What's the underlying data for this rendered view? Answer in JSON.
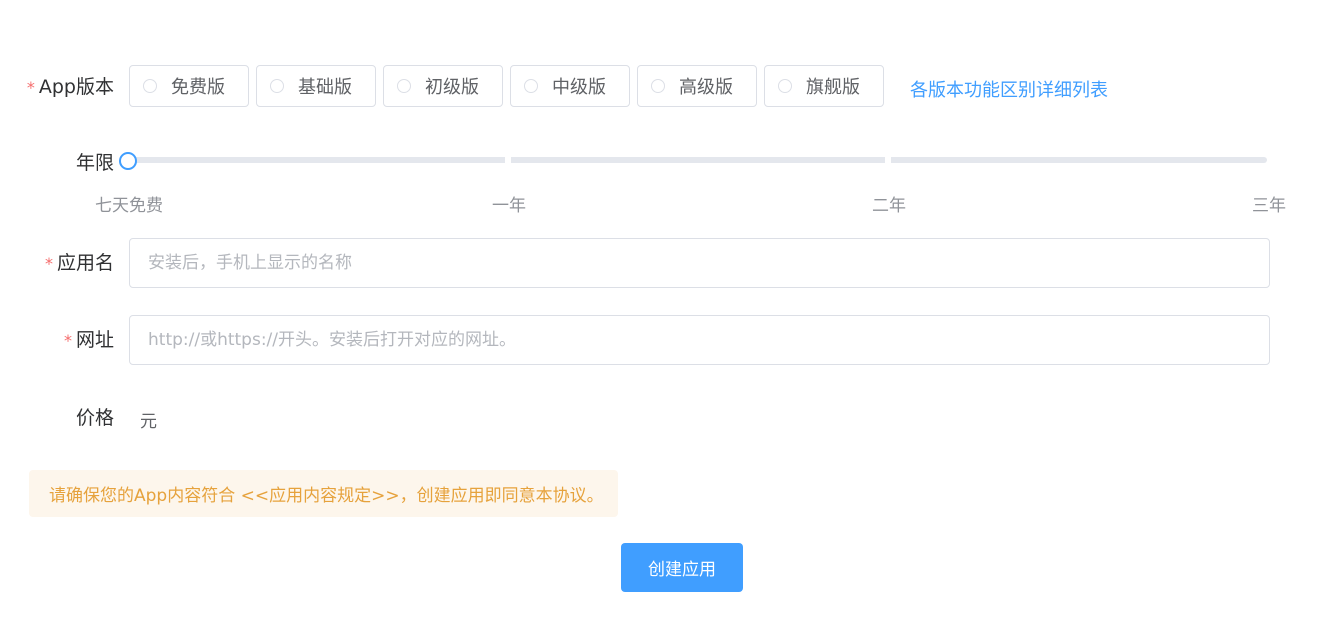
{
  "form": {
    "app_version": {
      "label": "App版本",
      "required_mark": "*",
      "options": [
        {
          "label": "免费版",
          "selected": false
        },
        {
          "label": "基础版",
          "selected": false
        },
        {
          "label": "初级版",
          "selected": false
        },
        {
          "label": "中级版",
          "selected": false
        },
        {
          "label": "高级版",
          "selected": false
        },
        {
          "label": "旗舰版",
          "selected": false
        }
      ],
      "compare_link": "各版本功能区别详细列表"
    },
    "duration": {
      "label": "年限",
      "marks": [
        "七天免费",
        "一年",
        "二年",
        "三年"
      ],
      "selected_index": 0
    },
    "app_name": {
      "label": "应用名",
      "required_mark": "*",
      "value": "",
      "placeholder": "安装后，手机上显示的名称"
    },
    "url": {
      "label": "网址",
      "required_mark": "*",
      "value": "",
      "placeholder": "http://或https://开头。安装后打开对应的网址。"
    },
    "price": {
      "label": "价格",
      "value": "元"
    },
    "notice": "请确保您的App内容符合 <<应用内容规定>>，创建应用即同意本协议。",
    "submit_label": "创建应用"
  },
  "colors": {
    "primary": "#409eff",
    "required": "#f56c6c",
    "warning_text": "#e6a23c",
    "warning_bg": "#fdf6ec",
    "border": "#dcdfe6"
  }
}
